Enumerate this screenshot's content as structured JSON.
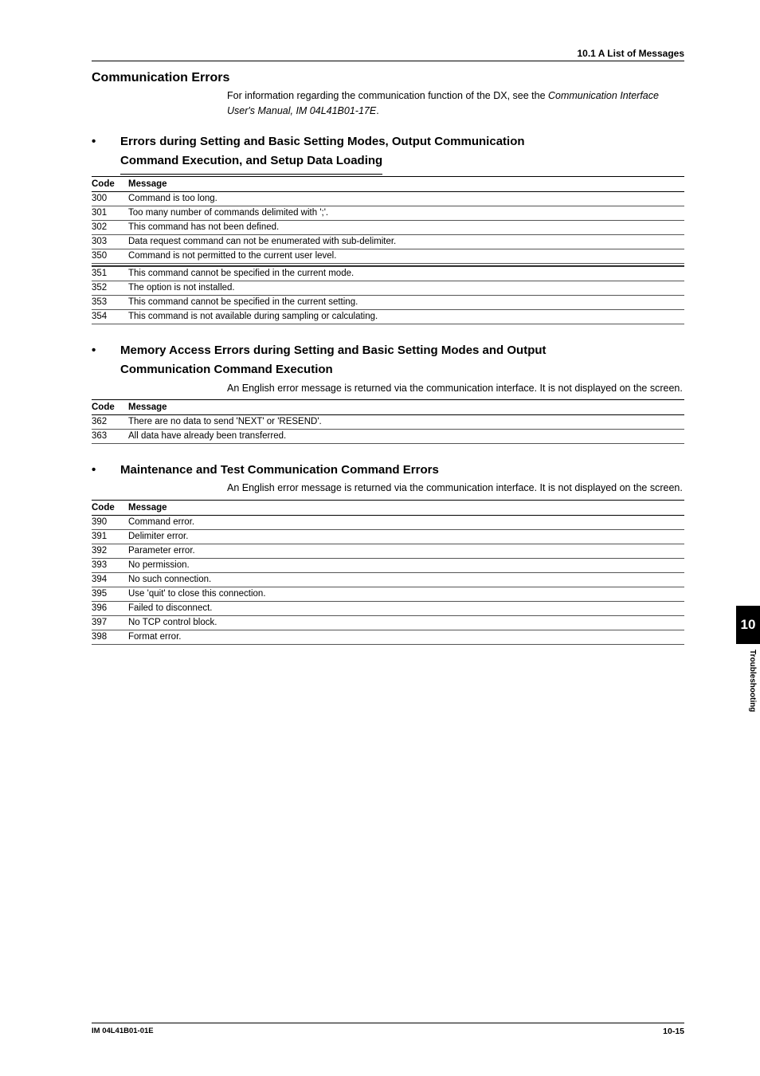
{
  "header": {
    "title": "10.1 A List of Messages"
  },
  "section": {
    "title": "Communication Errors",
    "intro_a": "For information regarding the communication function of the DX, see the ",
    "intro_b": "Communication Interface User's Manual, IM 04L41B01-17E",
    "intro_c": "."
  },
  "sub1": {
    "line1": "Errors during Setting and Basic Setting Modes, Output Communication",
    "line2": "Command Execution, and Setup Data Loading",
    "code_h": "Code",
    "msg_h": "Message",
    "rows": [
      {
        "c": "300",
        "m": "Command is too long."
      },
      {
        "c": "301",
        "m": "Too many number of commands delimited with ';'."
      },
      {
        "c": "302",
        "m": "This command has not been defined."
      },
      {
        "c": "303",
        "m": "Data request command can not be enumerated with sub-delimiter."
      },
      {
        "c": "350",
        "m": "Command is not permitted to the current user level."
      },
      {
        "c": "351",
        "m": "This command cannot be specified in the current mode."
      },
      {
        "c": "352",
        "m": "The option is not installed."
      },
      {
        "c": "353",
        "m": "This command cannot be specified in the current setting."
      },
      {
        "c": "354",
        "m": "This command is not available during sampling or calculating."
      }
    ]
  },
  "sub2": {
    "line1": "Memory Access Errors during Setting and Basic Setting Modes and Output",
    "line2": "Communication Command Execution",
    "note": "An English error message is returned via the communication interface. It is not displayed on the screen.",
    "code_h": "Code",
    "msg_h": "Message",
    "rows": [
      {
        "c": "362",
        "m": "There are no data to send 'NEXT' or 'RESEND'."
      },
      {
        "c": "363",
        "m": "All data have already been transferred."
      }
    ]
  },
  "sub3": {
    "line1": "Maintenance and Test Communication Command Errors",
    "note": "An English error message is returned via the communication interface. It is not displayed on the screen.",
    "code_h": "Code",
    "msg_h": "Message",
    "rows": [
      {
        "c": "390",
        "m": "Command error."
      },
      {
        "c": "391",
        "m": "Delimiter error."
      },
      {
        "c": "392",
        "m": "Parameter error."
      },
      {
        "c": "393",
        "m": "No permission."
      },
      {
        "c": "394",
        "m": "No such connection."
      },
      {
        "c": "395",
        "m": "Use 'quit' to close this connection."
      },
      {
        "c": "396",
        "m": "Failed to disconnect."
      },
      {
        "c": "397",
        "m": "No TCP control block."
      },
      {
        "c": "398",
        "m": "Format error."
      }
    ]
  },
  "sidebar": {
    "num": "10",
    "label": "Troubleshooting"
  },
  "footer": {
    "left": "IM 04L41B01-01E",
    "right": "10-15"
  },
  "bullet": "•"
}
